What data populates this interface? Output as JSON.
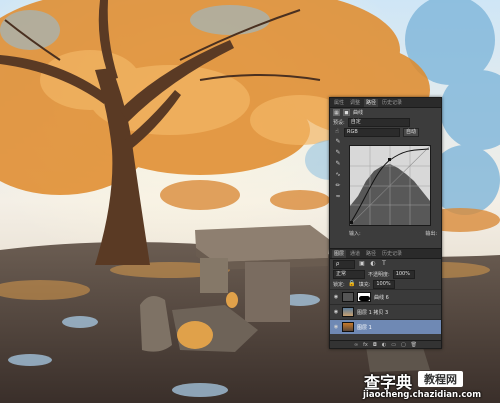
{
  "panel": {
    "tabs": [
      "属性",
      "调整",
      "路径",
      "历史记录"
    ],
    "preset_label": "预设:",
    "preset_value": "自定",
    "channel_value": "RGB",
    "auto_label": "自动",
    "input_label": "输入:",
    "output_label": "输出:"
  },
  "layers": {
    "tabs": [
      "图层",
      "通道",
      "路径",
      "历史记录"
    ],
    "blend_mode": "正常",
    "opacity_label": "不透明度:",
    "opacity_value": "100%",
    "lock_label": "锁定:",
    "fill_label": "填充:",
    "fill_value": "100%",
    "items": [
      {
        "name": "曲线 6"
      },
      {
        "name": "图层 1 拷贝 3"
      },
      {
        "name": "图层 1"
      }
    ]
  },
  "watermark": {
    "logo": "查字典",
    "sub": "教程网",
    "url": "jiaocheng.chazidian.com"
  },
  "colors": {
    "panel_bg": "#3c3c3c",
    "selected_layer": "#6f89b4",
    "foliage": "#e08a2a"
  }
}
